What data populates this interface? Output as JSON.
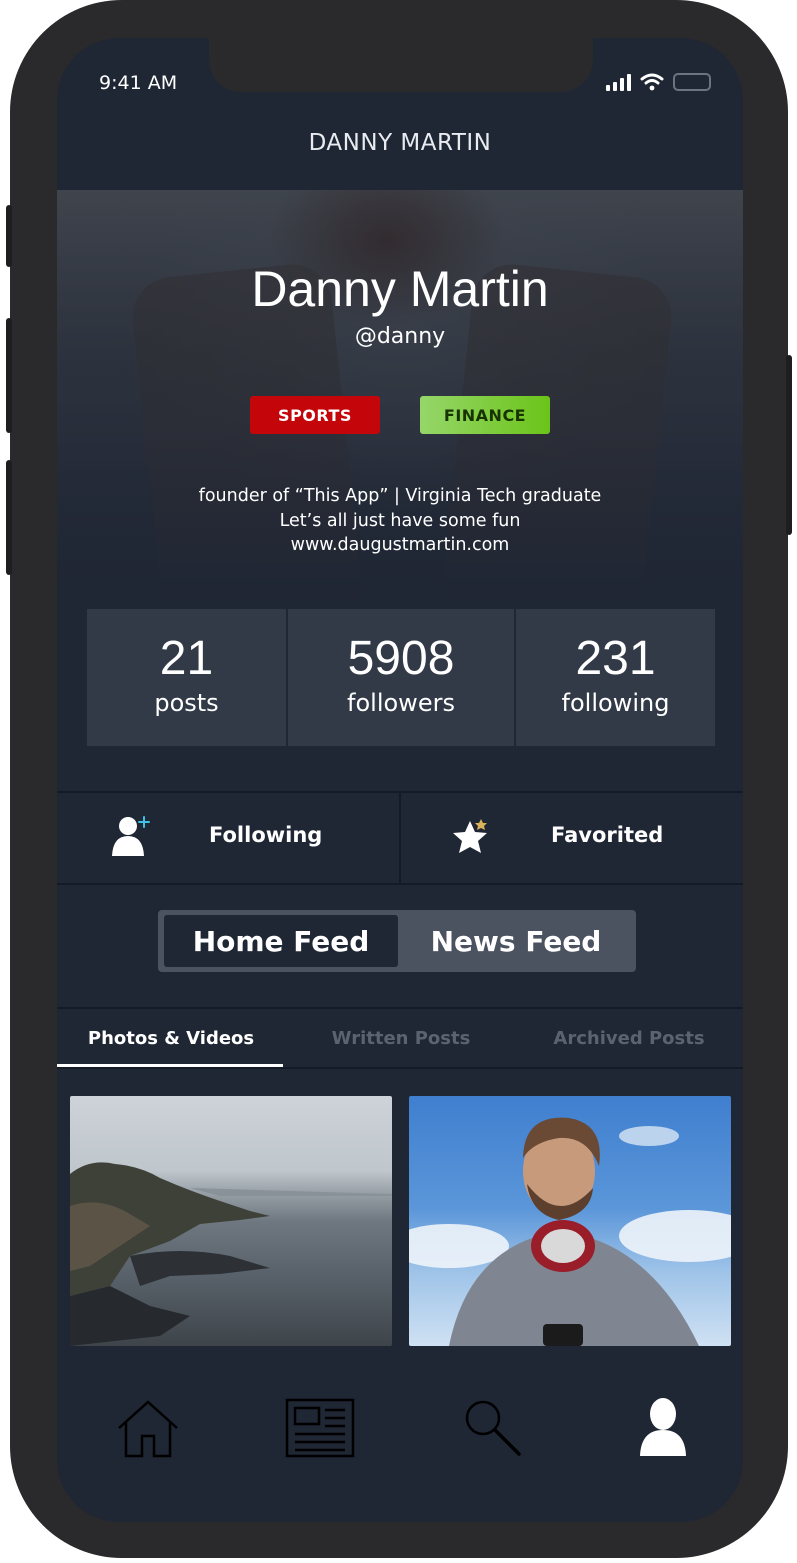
{
  "status": {
    "time": "9:41 AM"
  },
  "header": {
    "title": "DANNY MARTIN"
  },
  "profile": {
    "name": "Danny Martin",
    "handle": "@danny",
    "tags": [
      "SPORTS",
      "FINANCE"
    ],
    "bio": [
      "founder of “This App” | Virginia Tech graduate",
      "Let’s all just have some fun",
      "www.daugustmartin.com"
    ]
  },
  "stats": [
    {
      "value": "21",
      "label": "posts"
    },
    {
      "value": "5908",
      "label": "followers"
    },
    {
      "value": "231",
      "label": "following"
    }
  ],
  "actions": [
    {
      "label": "Following",
      "icon": "add-user-icon"
    },
    {
      "label": "Favorited",
      "icon": "star-icon"
    }
  ],
  "feed_toggle": {
    "options": [
      "Home Feed",
      "News Feed"
    ],
    "selected": "Home Feed"
  },
  "subtabs": {
    "items": [
      "Photos & Videos",
      "Written Posts",
      "Archived Posts"
    ],
    "active": "Photos & Videos"
  },
  "tabbar": {
    "items": [
      "home-icon",
      "news-icon",
      "search-icon",
      "profile-icon"
    ],
    "active": "profile-icon"
  },
  "colors": {
    "background": "#1f2634",
    "sports_tag": "#c4060b",
    "finance_tag": "#7bc72b",
    "accent_plus": "#3fc1e6",
    "star_badge": "#d9b35a"
  }
}
